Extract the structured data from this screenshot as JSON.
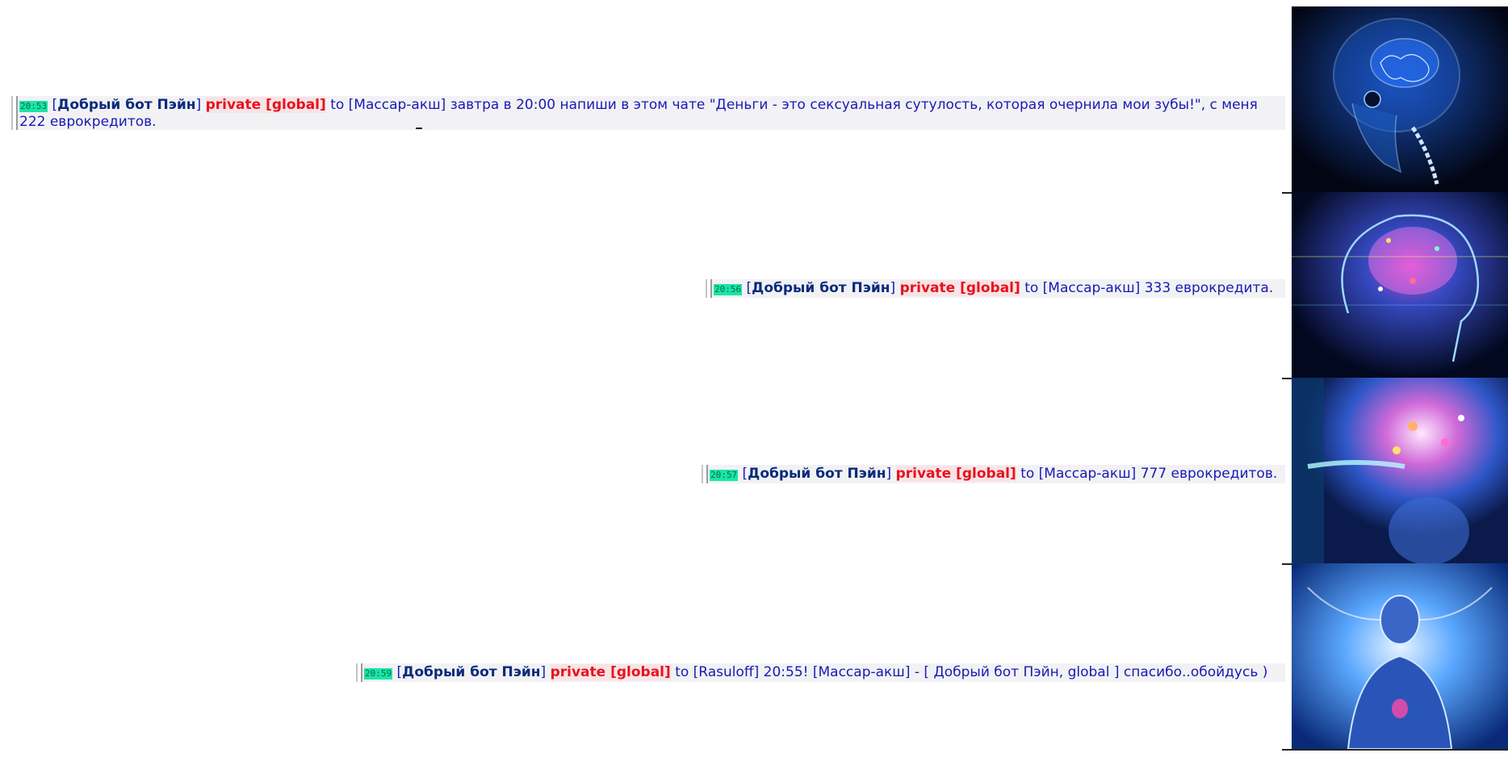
{
  "messages": [
    {
      "time": "20:53",
      "nick": "Добрый бот Пэйн",
      "channel": "private [global]",
      "text": "to [Массар-акш] завтра в 20:00 напиши в этом чате \"Деньги - это сексуальная сутулость, которая очернила мои зубы!\", с меня 222 еврокредитов."
    },
    {
      "time": "20:56",
      "nick": "Добрый бот Пэйн",
      "channel": "private [global]",
      "text": "to [Массар-акш] 333 еврокредита."
    },
    {
      "time": "20:57",
      "nick": "Добрый бот Пэйн",
      "channel": "private [global]",
      "text": "to [Массар-акш] 777 еврокредитов."
    },
    {
      "time": "20:59",
      "nick": "Добрый бот Пэйн",
      "channel": "private [global]",
      "text": "to [Rasuloff] 20:55! [Массар-акш] - [ Добрый бот Пэйн, global ] спасибо..обойдусь )"
    }
  ],
  "meme": {
    "panels": [
      "small-brain-xray",
      "glowing-brain",
      "cosmic-brain",
      "galaxy-brain-figure"
    ]
  },
  "colors": {
    "timestamp_bg": "#19e6a6",
    "nick": "#0a2a7c",
    "channel": "#e8121e",
    "message": "#1a1ab4"
  }
}
